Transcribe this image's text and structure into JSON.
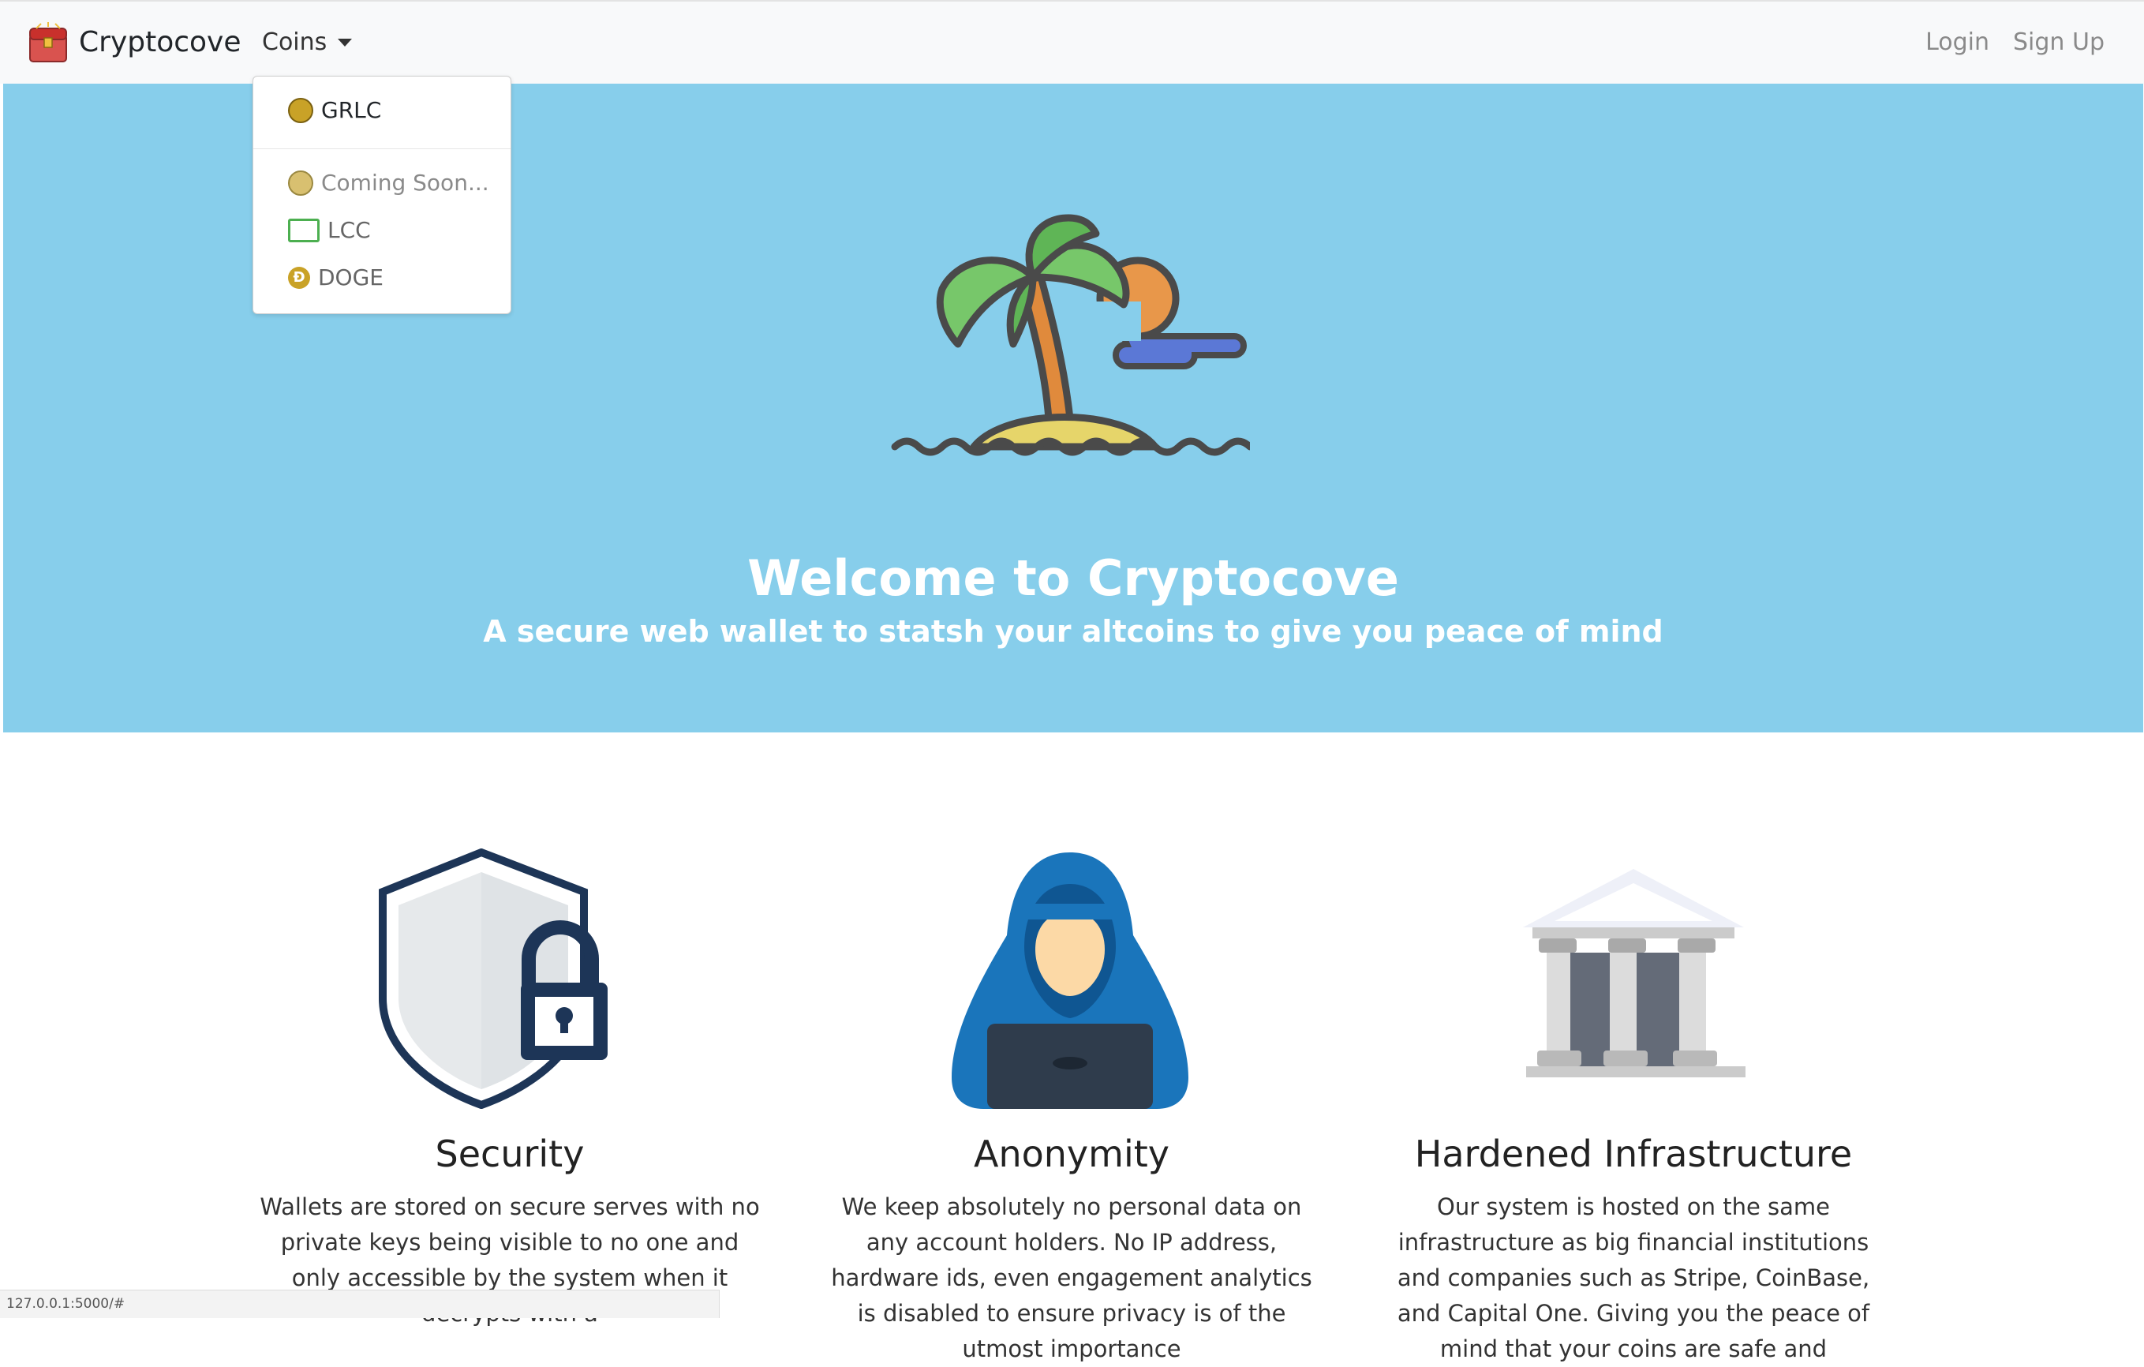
{
  "brand": {
    "name": "Cryptocove",
    "icon": "treasure-chest-icon"
  },
  "nav": {
    "coins_label": "Coins",
    "login": "Login",
    "signup": "Sign Up"
  },
  "dropdown": {
    "items": [
      {
        "label": "GRLC",
        "icon": "grlc-coin-icon"
      },
      {
        "label": "Coming Soon...",
        "icon": "coin-icon"
      },
      {
        "label": "LCC",
        "icon": "lcc-coin-icon"
      },
      {
        "label": "DOGE",
        "icon": "doge-coin-icon"
      }
    ]
  },
  "hero": {
    "title": "Welcome to Cryptocove",
    "subtitle": "A secure web wallet to statsh your altcoins to give you peace of mind",
    "illustration": "island-palm-icon"
  },
  "features": [
    {
      "title": "Security",
      "icon": "shield-lock-icon",
      "text": "Wallets are stored on secure serves with no private keys being visible to no one and only accessible by the system when it decrypts with a"
    },
    {
      "title": "Anonymity",
      "icon": "hooded-hacker-icon",
      "text": "We keep absolutely no personal data on any account holders. No IP address, hardware ids, even engagement analytics is disabled to ensure privacy is of the utmost importance"
    },
    {
      "title": "Hardened Infrastructure",
      "icon": "bank-building-icon",
      "text": "Our system is hosted on the same infrastructure as big financial institutions and companies such as Stripe, CoinBase, and Capital One. Giving you the peace of mind that your coins are safe and"
    }
  ],
  "status_url": "127.0.0.1:5000/#",
  "colors": {
    "hero_bg": "#87ceeb",
    "navbar_bg": "#f8f9fa"
  }
}
